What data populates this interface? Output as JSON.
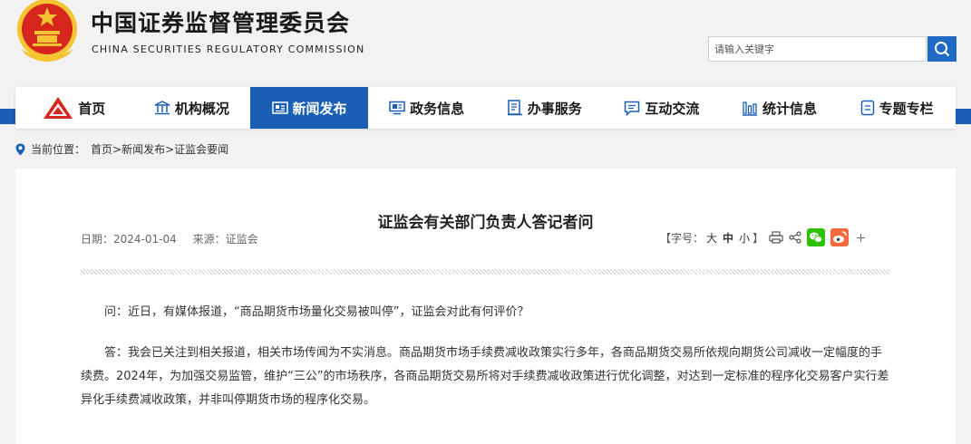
{
  "header": {
    "title": "中国证券监督管理委员会",
    "subtitle": "CHINA SECURITIES REGULATORY COMMISSION",
    "search_placeholder": "请输入关键字"
  },
  "nav": [
    {
      "label": "首页",
      "icon": "home-logo-icon",
      "active": false
    },
    {
      "label": "机构概况",
      "icon": "institution-icon",
      "active": false
    },
    {
      "label": "新闻发布",
      "icon": "news-icon",
      "active": true
    },
    {
      "label": "政务信息",
      "icon": "monitor-icon",
      "active": false
    },
    {
      "label": "办事服务",
      "icon": "document-list-icon",
      "active": false
    },
    {
      "label": "互动交流",
      "icon": "chat-icon",
      "active": false
    },
    {
      "label": "统计信息",
      "icon": "bar-chart-icon",
      "active": false
    },
    {
      "label": "专题专栏",
      "icon": "file-icon",
      "active": false
    }
  ],
  "breadcrumb": {
    "prefix": "当前位置：",
    "items": [
      "首页",
      "新闻发布",
      "证监会要闻"
    ],
    "separator": ">"
  },
  "article": {
    "title": "证监会有关部门负责人答记者问",
    "date": "日期：2024-01-04",
    "source": "来源：证监会",
    "font_size_label": "【字号：",
    "font_sizes": [
      "大",
      "中",
      "小"
    ],
    "font_size_close": "】",
    "paragraphs": [
      "问：近日，有媒体报道，“商品期货市场量化交易被叫停”，证监会对此有何评价？",
      "答：我会已关注到相关报道，相关市场传闻为不实消息。商品期货市场手续费减收政策实行多年，各商品期货交易所依规向期货公司减收一定幅度的手续费。2024年，为加强交易监管，维护“三公”的市场秩序，各商品期货交易所将对手续费减收政策进行优化调整，对达到一定标准的程序化交易客户实行差异化手续费减收政策，并非叫停期货市场的程序化交易。"
    ]
  },
  "colors": {
    "brand_blue": "#1a5fb4",
    "emblem_red": "#d7261e",
    "emblem_gold": "#f4c431",
    "wechat_green": "#2dc100",
    "weibo_orange": "#f26a3b"
  }
}
